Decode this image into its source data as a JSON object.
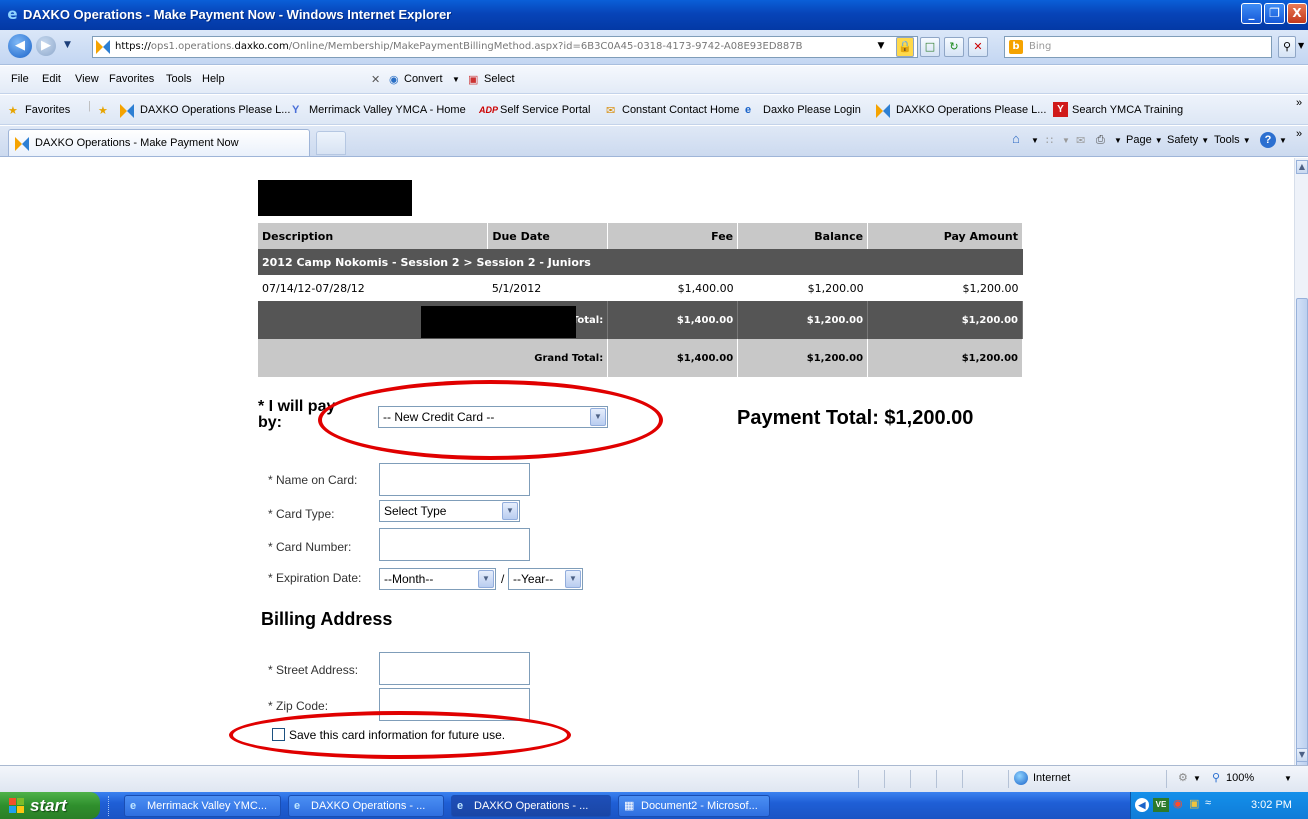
{
  "window": {
    "title": "DAXKO Operations - Make Payment Now - Windows Internet Explorer",
    "min_glyph": "_",
    "max_glyph": "❐",
    "close_glyph": "X"
  },
  "address_bar": {
    "url_scheme": "https://",
    "url_sub": "ops1.operations.",
    "url_host": "daxko.com",
    "url_path": "/Online/Membership/MakePaymentBillingMethod.aspx?id=6B3C0A45-0318-4173-9742-A08E93ED887B",
    "search_placeholder": "Bing"
  },
  "menu": {
    "items": [
      "File",
      "Edit",
      "View",
      "Favorites",
      "Tools",
      "Help"
    ],
    "convert_label": "Convert",
    "select_label": "Select"
  },
  "favorites_bar": {
    "label": "Favorites",
    "items": [
      "DAXKO Operations Please L...",
      "Merrimack Valley YMCA - Home",
      "Self Service Portal",
      "Constant Contact Home",
      "Daxko Please Login",
      "DAXKO Operations Please L...",
      "Search YMCA Training"
    ]
  },
  "tabs": {
    "active_tab": "DAXKO Operations - Make Payment Now",
    "commands": [
      "Page",
      "Safety",
      "Tools"
    ]
  },
  "fee_table": {
    "headers": [
      "Description",
      "Due Date",
      "Fee",
      "Balance",
      "Pay Amount"
    ],
    "group_label": "2012 Camp Nokomis - Session 2 > Session 2 - Juniors",
    "row": {
      "description": "07/14/12-07/28/12",
      "due_date": "5/1/2012",
      "fee": "$1,400.00",
      "balance": "$1,200.00",
      "pay_amount": "$1,200.00"
    },
    "total": {
      "label": "Total:",
      "fee": "$1,400.00",
      "balance": "$1,200.00",
      "pay_amount": "$1,200.00"
    },
    "grand_total": {
      "label": "Grand Total:",
      "fee": "$1,400.00",
      "balance": "$1,200.00",
      "pay_amount": "$1,200.00"
    }
  },
  "payment": {
    "pay_by_line1": "* I will pay",
    "pay_by_line2": "by:",
    "method_selected": "-- New Credit Card --",
    "payment_total": "Payment Total: $1,200.00",
    "name_label": "* Name on Card:",
    "card_type_label": "* Card Type:",
    "card_type_selected": "Select Type",
    "card_number_label": "* Card Number:",
    "expiration_label": "* Expiration Date:",
    "month_selected": "--Month--",
    "slash": "/",
    "year_selected": "--Year--"
  },
  "billing": {
    "heading": "Billing Address",
    "street_label": "* Street Address:",
    "zip_label": "* Zip Code:",
    "save_card_label": "Save this card information for future use."
  },
  "status_bar": {
    "zone": "Internet",
    "zoom": "100%"
  },
  "taskbar": {
    "start_label": "start",
    "tasks": [
      "Merrimack Valley YMC...",
      "DAXKO Operations - ...",
      "DAXKO Operations - ...",
      "Document2 - Microsof..."
    ],
    "clock": "3:02 PM"
  }
}
